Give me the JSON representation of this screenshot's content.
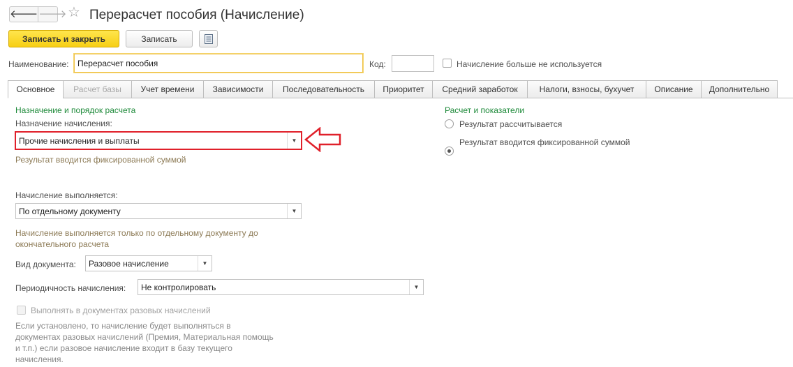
{
  "window": {
    "title": "Перерасчет пособия (Начисление)",
    "back_glyph": "🡐",
    "forward_glyph": "🡒",
    "star_glyph": "☆",
    "icons": [
      "arrow-left-icon",
      "arrow-right-icon",
      "star-icon",
      "list-icon"
    ]
  },
  "toolbar": {
    "save_close_label": "Записать и закрыть",
    "save_label": "Записать"
  },
  "header_fields": {
    "name_label": "Наименование:",
    "name_value": "Перерасчет пособия",
    "code_label": "Код:",
    "code_value": "",
    "unused_label": "Начисление больше не используется"
  },
  "tabs": [
    {
      "label": "Основное"
    },
    {
      "label": "Расчет базы"
    },
    {
      "label": "Учет времени"
    },
    {
      "label": "Зависимости"
    },
    {
      "label": "Последовательность"
    },
    {
      "label": "Приоритет"
    },
    {
      "label": "Средний заработок"
    },
    {
      "label": "Налоги, взносы, бухучет"
    },
    {
      "label": "Описание"
    },
    {
      "label": "Дополнительно"
    }
  ],
  "left": {
    "group_title": "Назначение и порядок расчета",
    "purpose_label": "Назначение начисления:",
    "purpose_value": "Прочие начисления и выплаты",
    "purpose_hint": "Результат вводится фиксированной суммой",
    "exec_label": "Начисление выполняется:",
    "exec_value": "По отдельному документу",
    "exec_hint_1": "Начисление выполняется только по отдельному документу до",
    "exec_hint_2": "окончательного расчета",
    "doc_type_label": "Вид документа:",
    "doc_type_value": "Разовое начисление",
    "period_label": "Периодичность начисления:",
    "period_value": "Не контролировать",
    "one_time_label": "Выполнять в документах разовых начислений",
    "one_time_hint_1": "Если установлено, то начисление будет выполняться в",
    "one_time_hint_2": "документах разовых начислений (Премия, Материальная помощь",
    "one_time_hint_3": "и т.п.) если разовое начисление входит в базу текущего",
    "one_time_hint_4": "начисления."
  },
  "right": {
    "group_title": "Расчет и показатели",
    "radio_calc": "Результат рассчитывается",
    "radio_fixed": "Результат вводится фиксированной суммой",
    "selected": "fixed"
  },
  "colors": {
    "accent_yellow": "#f7cf14",
    "group_green": "#1e8a3a",
    "hint_brown": "#8c7a55",
    "annotation_red": "#e0202a"
  }
}
